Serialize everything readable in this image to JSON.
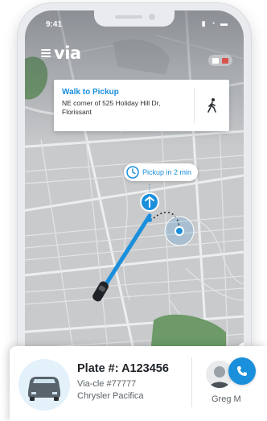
{
  "status_bar": {
    "time": "9:41",
    "icons": "▮ ◔ ▬"
  },
  "app": {
    "logo": "via",
    "menu_icon": "hamburger-icon",
    "payment_icons": [
      "person-icon",
      "credit-card-icon"
    ]
  },
  "walk_card": {
    "title": "Walk to Pickup",
    "address": "NE corner of 525 Holiday Hill Dr, Florissant",
    "icon": "walking-person-icon"
  },
  "pickup_eta": {
    "label": "Pickup in 2 min",
    "icon": "clock-icon"
  },
  "driver_panel": {
    "plate": "Plate #: A123456",
    "vehicle_id": "Via-cle #77777",
    "vehicle_model": "Chrysler Pacifica",
    "driver_name": "Greg M",
    "call_icon": "phone-icon"
  },
  "colors": {
    "accent": "#1a8fdc",
    "map_road": "#ffffff",
    "map_bg": "#c9cbcd",
    "park": "#7fbf7a"
  }
}
